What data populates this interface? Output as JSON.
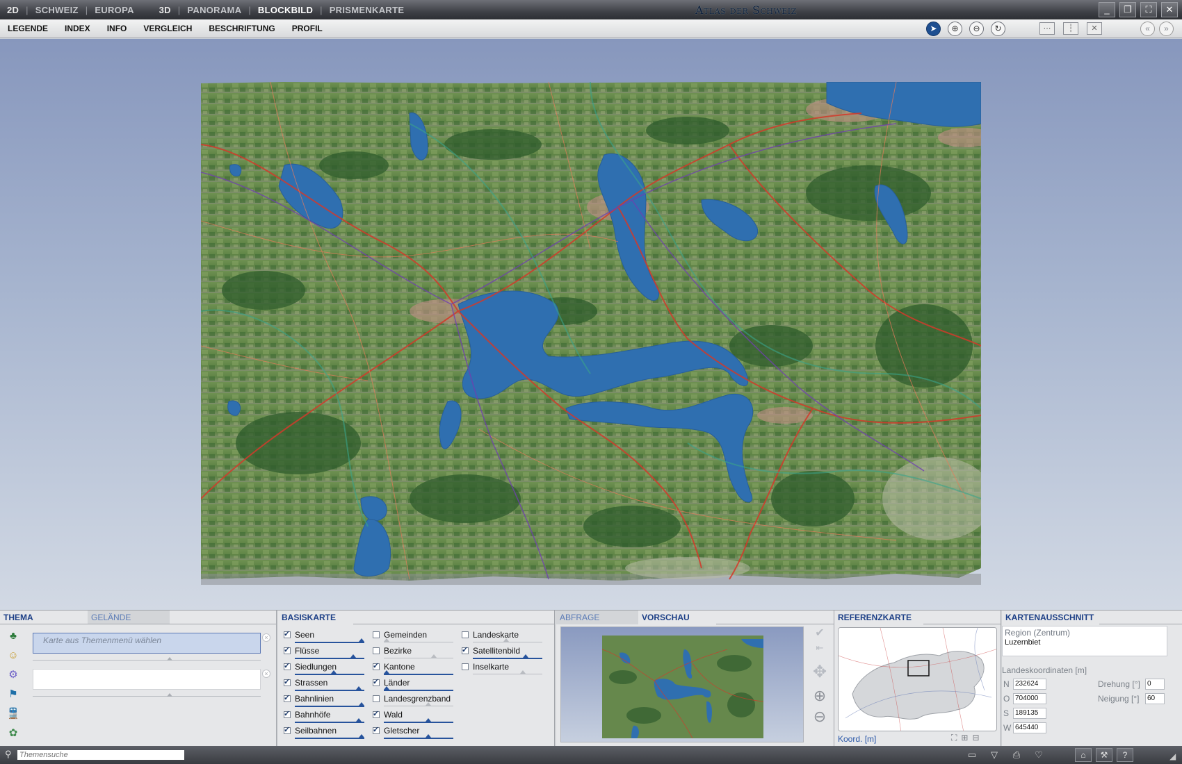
{
  "titlebar": {
    "modes_2d_label": "2D",
    "mode_schweiz": "SCHWEIZ",
    "mode_europa": "EUROPA",
    "modes_3d_label": "3D",
    "mode_panorama": "PANORAMA",
    "mode_blockbild": "BLOCKBILD",
    "mode_prismenkarte": "PRISMENKARTE",
    "app_title": "Atlas der Schweiz",
    "window_controls": [
      "minimize-icon",
      "restore-icon",
      "fullscreen-icon",
      "close-icon"
    ]
  },
  "menubar": {
    "items": [
      "LEGENDE",
      "INDEX",
      "INFO",
      "VERGLEICH",
      "BESCHRIFTUNG",
      "PROFIL"
    ],
    "tools": [
      "pointer-icon",
      "zoom-in-icon",
      "zoom-out-icon",
      "rotate-icon"
    ],
    "view_tools": [
      "horizontal-split-icon",
      "vertical-split-icon",
      "no-split-icon"
    ],
    "nav": [
      "back-icon",
      "forward-icon"
    ]
  },
  "thema": {
    "tab_thema": "THEMA",
    "tab_gelaende": "GELÄNDE",
    "field_placeholder": "Karte aus Themenmenü wählen",
    "side_icons": [
      "nature-icon",
      "society-icon",
      "economy-icon",
      "politics-icon",
      "transport-icon",
      "environment-icon"
    ]
  },
  "basiskarte": {
    "tab": "BASISKARTE",
    "col1": [
      {
        "label": "Seen",
        "checked": true
      },
      {
        "label": "Flüsse",
        "checked": true
      },
      {
        "label": "Siedlungen",
        "checked": true
      },
      {
        "label": "Strassen",
        "checked": true
      },
      {
        "label": "Bahnlinien",
        "checked": true
      },
      {
        "label": "Bahnhöfe",
        "checked": true
      },
      {
        "label": "Seilbahnen",
        "checked": true
      }
    ],
    "col2": [
      {
        "label": "Gemeinden",
        "checked": false
      },
      {
        "label": "Bezirke",
        "checked": false
      },
      {
        "label": "Kantone",
        "checked": true
      },
      {
        "label": "Länder",
        "checked": true
      },
      {
        "label": "Landesgrenzband",
        "checked": false
      },
      {
        "label": "Wald",
        "checked": true
      },
      {
        "label": "Gletscher",
        "checked": true
      }
    ],
    "col3": [
      {
        "label": "Landeskarte",
        "checked": false
      },
      {
        "label": "Satellitenbild",
        "checked": true
      },
      {
        "label": "Inselkarte",
        "checked": false
      }
    ]
  },
  "vorschau": {
    "tab_abfrage": "ABFRAGE",
    "tab_vorschau": "VORSCHAU"
  },
  "referenzkarte": {
    "tab": "REFERENZKARTE",
    "koord_label": "Koord. [m]"
  },
  "kartenausschnitt": {
    "tab": "KARTENAUSSCHNITT",
    "region_type": "Region (Zentrum)",
    "region_name": "Luzernbiet",
    "coord_title": "Landeskoordinaten [m]",
    "n_label": "N",
    "n_value": "232624",
    "o_label": "O",
    "o_value": "704000",
    "s_label": "S",
    "s_value": "189135",
    "w_label": "W",
    "w_value": "645440",
    "drehung_label": "Drehung [°]",
    "drehung_value": "0",
    "neigung_label": "Neigung [°]",
    "neigung_value": "60"
  },
  "statusbar": {
    "search_placeholder": "Themensuche",
    "icons": [
      "folder-icon",
      "print-preview-icon",
      "print-icon",
      "export-icon"
    ],
    "icons2": [
      "home-icon",
      "settings-icon",
      "help-icon"
    ]
  },
  "colors": {
    "accent": "#1c3f86",
    "lake": "#2f6fb0",
    "terrain": "#6e8f4f",
    "forest": "#2e5a2c"
  }
}
